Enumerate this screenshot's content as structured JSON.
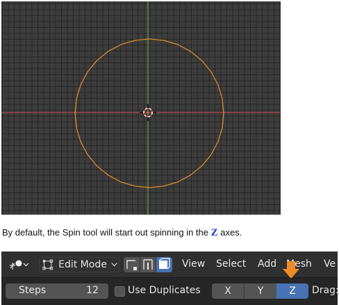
{
  "caption": {
    "before": "By default, the Spin tool will start out spinning in the ",
    "axis": "Z",
    "after": " axes."
  },
  "header": {
    "mode_label": "Edit Mode",
    "menus": [
      "View",
      "Select",
      "Add",
      "Mesh",
      "Ve"
    ]
  },
  "tool_settings": {
    "steps_label": "Steps",
    "steps_value": "12",
    "use_duplicates_label": "Use Duplicates",
    "axes": [
      "X",
      "Y",
      "Z"
    ],
    "active_axis": "Z",
    "drag_label": "Drag:"
  },
  "colors": {
    "circle": "#e08b2c",
    "x_axis": "#b3444f",
    "y_axis": "#6c9a32",
    "active_button": "#4772b3",
    "arrow": "#f08a24",
    "caption_axis": "#1a35c6"
  },
  "icons": [
    "cursor-tool-icon",
    "select-box-icon",
    "vertex-select-icon",
    "edge-select-icon",
    "face-select-icon",
    "orange-down-arrow-icon",
    "3d-cursor-icon"
  ]
}
